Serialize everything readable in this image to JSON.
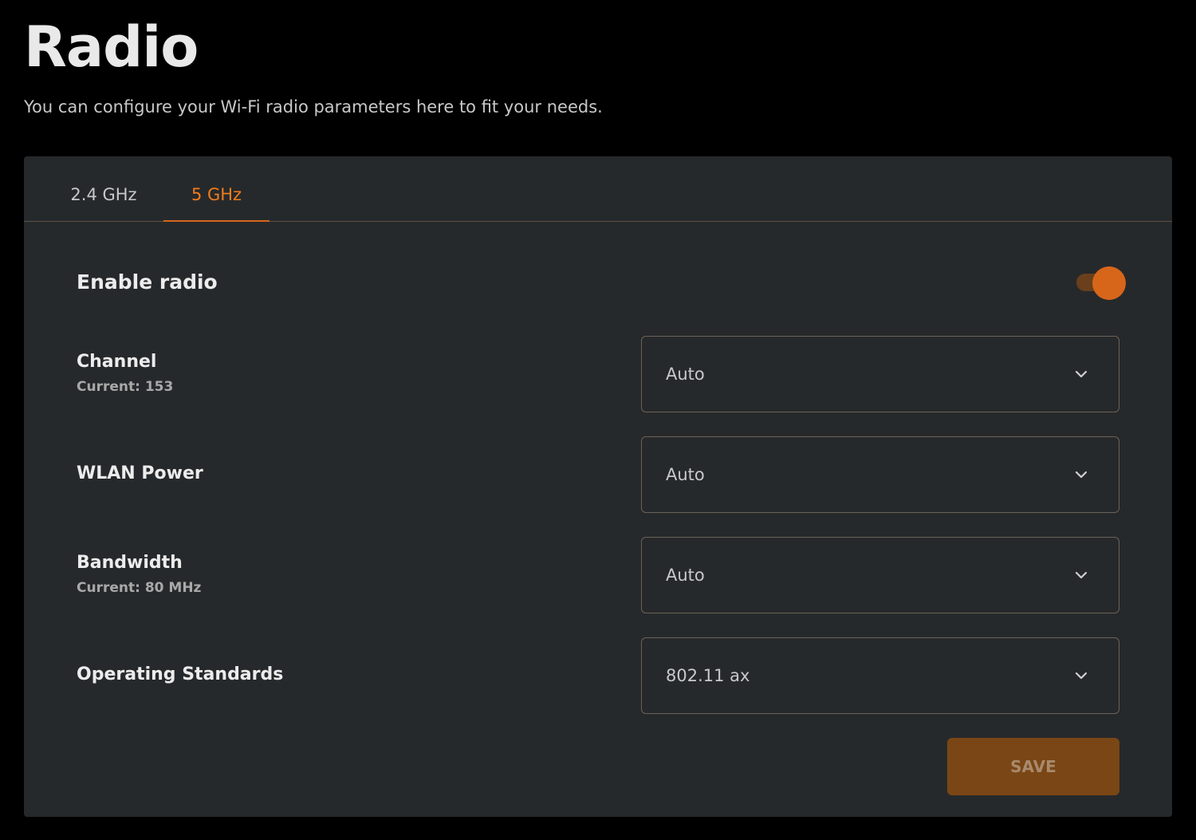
{
  "header": {
    "title": "Radio",
    "subtitle": "You can configure your Wi-Fi radio parameters here to fit your needs."
  },
  "tabs": [
    {
      "label": "2.4 GHz",
      "active": false
    },
    {
      "label": "5 GHz",
      "active": true
    }
  ],
  "enable_radio": {
    "label": "Enable radio",
    "enabled": true
  },
  "settings": {
    "channel": {
      "label": "Channel",
      "current": "Current: 153",
      "value": "Auto"
    },
    "wlan_power": {
      "label": "WLAN Power",
      "value": "Auto"
    },
    "bandwidth": {
      "label": "Bandwidth",
      "current": "Current: 80 MHz",
      "value": "Auto"
    },
    "operating_standards": {
      "label": "Operating Standards",
      "value": "802.11 ax"
    }
  },
  "actions": {
    "save_label": "SAVE"
  },
  "icons": {
    "select": "chevron-down-icon"
  },
  "colors": {
    "accent": "#d7661b",
    "accent_text": "#f07c1e",
    "background": "#000000",
    "card": "#26292b",
    "save_button": "#7a4615"
  }
}
